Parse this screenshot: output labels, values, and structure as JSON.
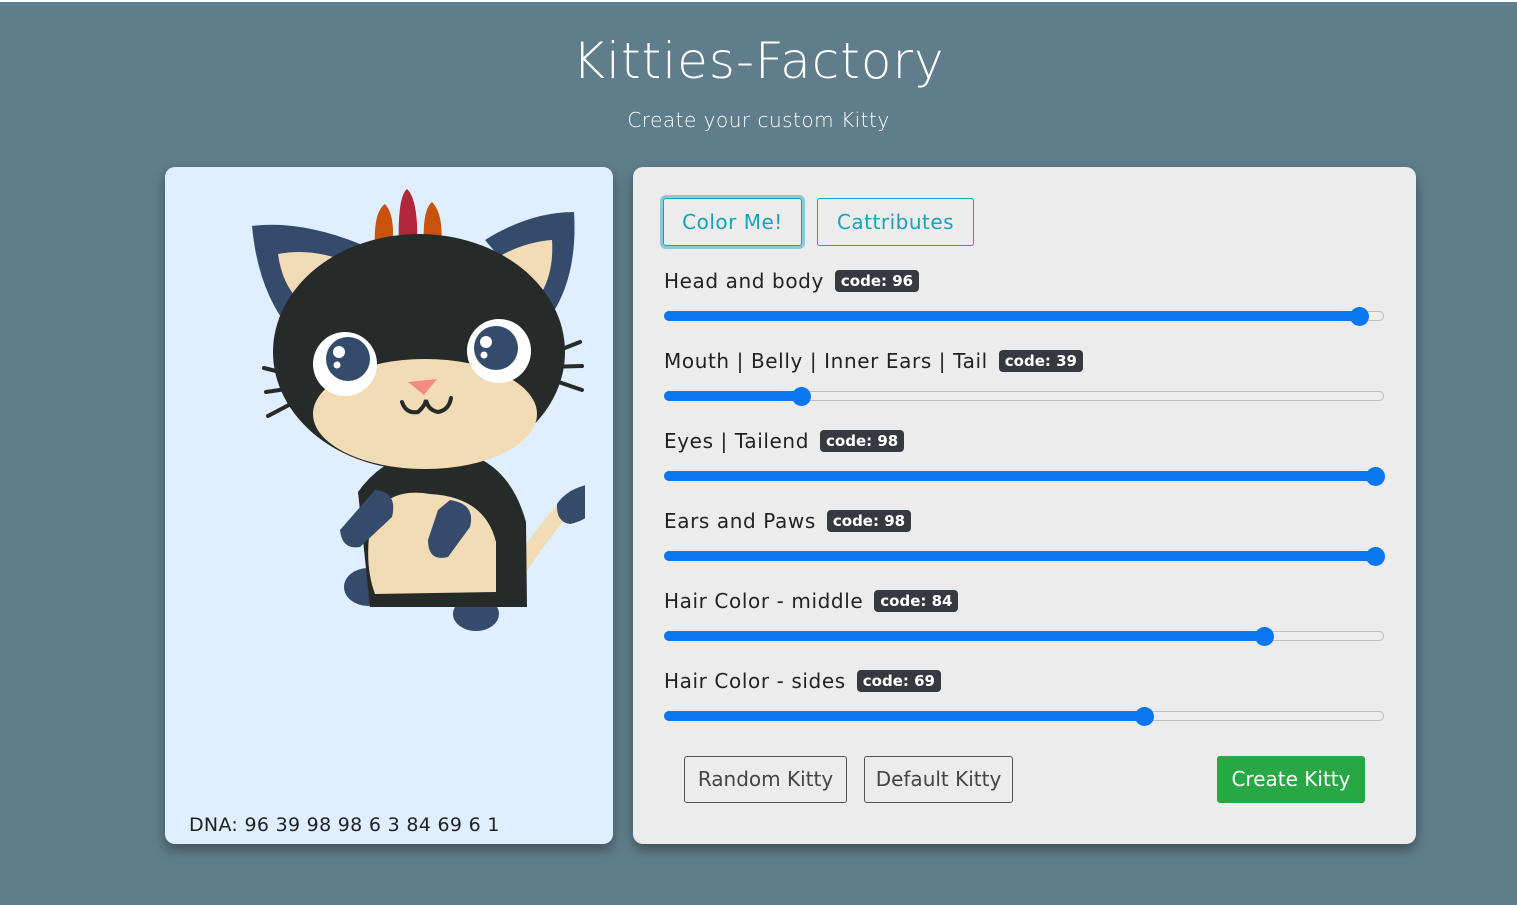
{
  "header": {
    "title": "Kitties-Factory",
    "subtitle": "Create your custom Kitty"
  },
  "cat_card": {
    "dna_label": "DNA: 96 39 98 98 6 3 84 69 6 1"
  },
  "tabs": [
    {
      "label": "Color Me!",
      "active": true
    },
    {
      "label": "Cattributes",
      "active": false
    }
  ],
  "sliders": [
    {
      "label": "Head and body",
      "badge": "code: 96",
      "value": 96,
      "min": 10,
      "max": 98
    },
    {
      "label": "Mouth | Belly | Inner Ears | Tail",
      "badge": "code: 39",
      "value": 39,
      "min": 26,
      "max": 98
    },
    {
      "label": "Eyes | Tailend",
      "badge": "code: 98",
      "value": 98,
      "min": 10,
      "max": 98
    },
    {
      "label": "Ears and Paws",
      "badge": "code: 98",
      "value": 98,
      "min": 10,
      "max": 98
    },
    {
      "label": "Hair Color - middle",
      "badge": "code: 84",
      "value": 84,
      "min": 10,
      "max": 98
    },
    {
      "label": "Hair Color - sides",
      "badge": "code: 69",
      "value": 69,
      "min": 10,
      "max": 98
    }
  ],
  "buttons": {
    "random": "Random Kitty",
    "default": "Default Kitty",
    "create": "Create Kitty"
  },
  "colors": {
    "background": "#607d8b",
    "cat_card": "#dfefff",
    "control_card": "#ececec",
    "slider_accent": "#0b76f0",
    "tab_accent": "#17a2b8",
    "create_button": "#28a745",
    "badge": "#343a40",
    "cat_body": "#262b2a",
    "cat_ears_paws": "#344b6b",
    "cat_belly": "#f2dcb5",
    "hair_middle": "#b0263b",
    "hair_sides": "#c9520c"
  }
}
